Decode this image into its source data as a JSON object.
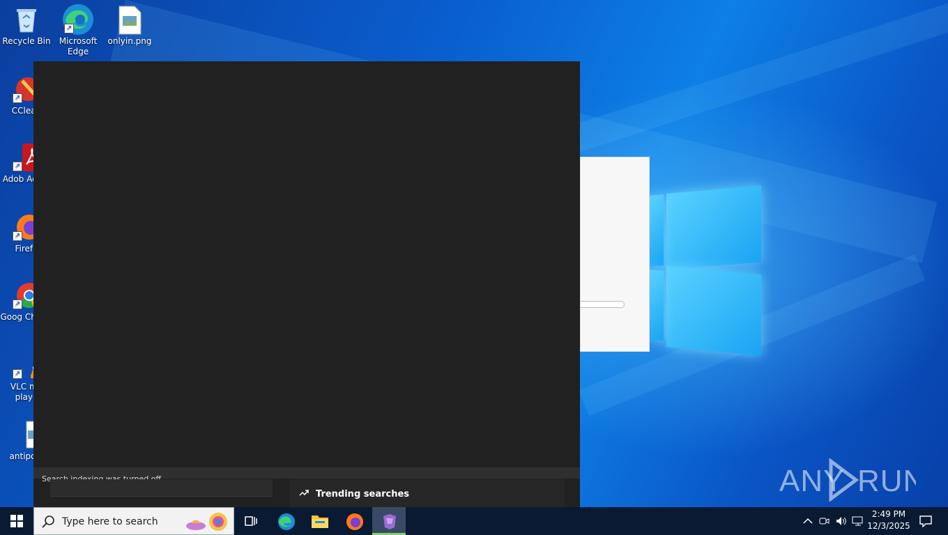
{
  "desktop": {
    "icons": [
      {
        "label": "Recycle Bin"
      },
      {
        "label": "Microsoft Edge"
      },
      {
        "label": "onlyin.png"
      },
      {
        "label": "CClean"
      },
      {
        "label": "Adob Acrob"
      },
      {
        "label": "Firefo"
      },
      {
        "label": "Goog Chrom"
      },
      {
        "label": "VLC me playe"
      },
      {
        "label": "antipost"
      }
    ],
    "watermark": "ANY RUN"
  },
  "search_panel": {
    "status_text": "Search indexing was turned off.",
    "trending_label": "Trending searches"
  },
  "taskbar": {
    "search_placeholder": "Type here to search",
    "pinned": [
      "task-view",
      "microsoft-edge",
      "file-explorer",
      "firefox",
      "active-app"
    ],
    "clock_time": "2:49 PM",
    "clock_date": "12/3/2025"
  },
  "colors": {
    "panel_bg": "#212121",
    "taskbar_bg": "#0a1a33",
    "active_indicator": "#7fd16a"
  }
}
